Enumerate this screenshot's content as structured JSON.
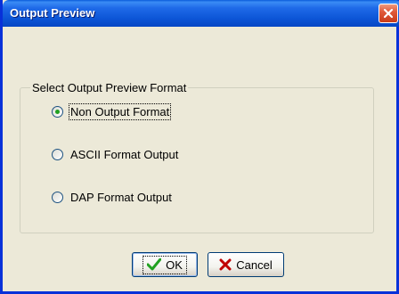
{
  "window": {
    "title": "Output Preview"
  },
  "group": {
    "label": "Select Output Preview Format"
  },
  "options": [
    {
      "label": "Non Output Format",
      "checked": true
    },
    {
      "label": "ASCII Format Output",
      "checked": false
    },
    {
      "label": "DAP Format Output",
      "checked": false
    }
  ],
  "buttons": {
    "ok_label": "OK",
    "cancel_label": "Cancel"
  },
  "icons": {
    "close": "close-icon",
    "ok": "checkmark-icon",
    "cancel": "x-icon"
  },
  "colors": {
    "title_bar": "#0c55d6",
    "close_button": "#c83b19",
    "checkmark": "#21a121",
    "cancel_x": "#c00000"
  }
}
